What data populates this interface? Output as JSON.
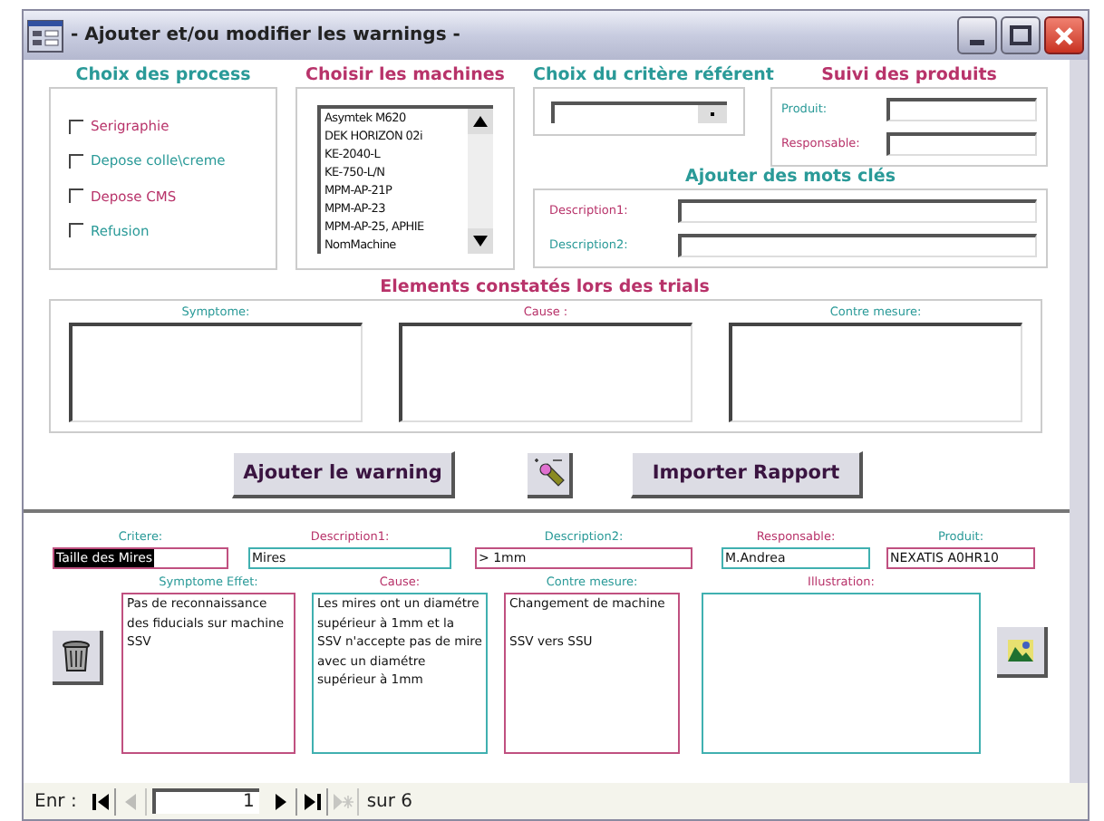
{
  "window": {
    "title": "- Ajouter et/ou modifier les warnings -"
  },
  "process": {
    "title": "Choix des process",
    "items": [
      {
        "label": "Serigraphie",
        "checked": false
      },
      {
        "label": "Depose colle\\creme",
        "checked": false
      },
      {
        "label": "Depose CMS",
        "checked": false
      },
      {
        "label": "Refusion",
        "checked": false
      }
    ]
  },
  "machines": {
    "title": "Choisir les machines",
    "items": [
      "Asymtek M620",
      "DEK HORIZON 02i",
      "KE-2040-L",
      "KE-750-L/N",
      "MPM-AP-21P",
      "MPM-AP-23",
      "MPM-AP-25, APHIE",
      "NomMachine"
    ]
  },
  "critere": {
    "title": "Choix du critère référent"
  },
  "suivi": {
    "title": "Suivi des produits",
    "fields": [
      {
        "label": "Produit:"
      },
      {
        "label": "Responsable:"
      }
    ]
  },
  "mots_cles": {
    "title": "Ajouter des mots clés",
    "fields": [
      {
        "label": "Description1:"
      },
      {
        "label": "Description2:"
      }
    ]
  },
  "elements": {
    "title": "Elements constatés lors des trials",
    "columns": [
      "Symptome:",
      "Cause :",
      "Contre mesure:"
    ]
  },
  "buttons": [
    "Ajouter le warning",
    "Importer Rapport"
  ],
  "record": {
    "fields": [
      {
        "label": "Critere:",
        "value": "Taille des Mires",
        "highlighted": true
      },
      {
        "label": "Description1:",
        "value": "Mires",
        "highlighted": false
      },
      {
        "label": "Description2:",
        "value": "> 1mm",
        "highlighted": false
      },
      {
        "label": "Responsable:",
        "value": "M.Andrea",
        "highlighted": false
      },
      {
        "label": "Produit:",
        "value": "NEXATIS  A0HR10",
        "highlighted": false
      }
    ],
    "memos": [
      {
        "label": "Symptome Effet:",
        "value": "Pas de reconnaissance des fiducials sur machine SSV"
      },
      {
        "label": "Cause:",
        "value": "Les mires ont un diamétre supérieur à 1mm et la SSV n'accepte pas de mire avec un diamétre supérieur à 1mm"
      },
      {
        "label": "Contre mesure:",
        "value": "Changement de machine\n\nSSV vers SSU"
      }
    ],
    "illustration": {
      "label": "Illustration:"
    }
  },
  "navigation": {
    "label": "Enr :",
    "current": "1",
    "total": "sur 6"
  }
}
